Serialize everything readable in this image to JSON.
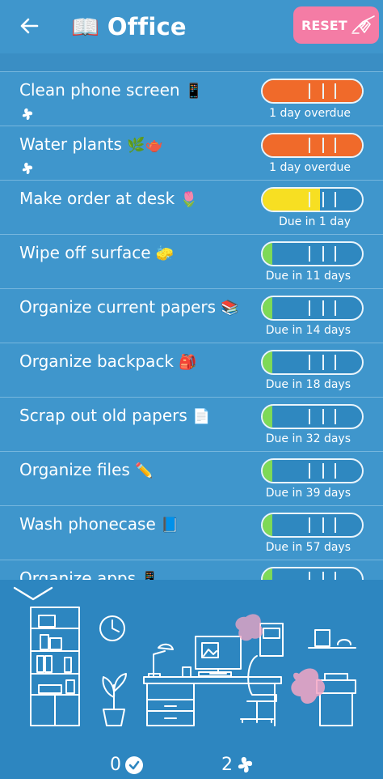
{
  "header": {
    "title": "Office",
    "title_icon": "📖",
    "reset_label": "RESET"
  },
  "tasks": [
    {
      "label": "Clean phone screen",
      "emoji": "📱",
      "due": "1 day  overdue",
      "level": 1.0,
      "status": "overdue",
      "color": "#f06a2a",
      "snoozed": true
    },
    {
      "label": "Water plants",
      "emoji": "🌿🫖",
      "due": "1 day  overdue",
      "level": 1.0,
      "status": "overdue",
      "color": "#f06a2a",
      "snoozed": true
    },
    {
      "label": "Make order at desk",
      "emoji": "🌷",
      "due": "Due in 1 day",
      "level": 0.58,
      "status": "soon",
      "color": "#f7df22",
      "snoozed": false
    },
    {
      "label": "Wipe off surface",
      "emoji": "🧽",
      "due": "Due in 11 days",
      "level": 0.1,
      "status": "ok",
      "color": "#7ed957",
      "snoozed": false
    },
    {
      "label": "Organize current papers",
      "emoji": "📚",
      "due": "Due in 14 days",
      "level": 0.1,
      "status": "ok",
      "color": "#7ed957",
      "snoozed": false
    },
    {
      "label": "Organize backpack",
      "emoji": "🎒",
      "due": "Due in 18 days",
      "level": 0.1,
      "status": "ok",
      "color": "#7ed957",
      "snoozed": false
    },
    {
      "label": "Scrap out old papers",
      "emoji": "📄",
      "due": "Due in 32 days",
      "level": 0.1,
      "status": "ok",
      "color": "#7ed957",
      "snoozed": false
    },
    {
      "label": "Organize files",
      "emoji": "✏️",
      "due": "Due in 39 days",
      "level": 0.1,
      "status": "ok",
      "color": "#7ed957",
      "snoozed": false
    },
    {
      "label": "Wash phonecase",
      "emoji": "📘",
      "due": "Due in 57 days",
      "level": 0.1,
      "status": "ok",
      "color": "#7ed957",
      "snoozed": false
    },
    {
      "label": "Organize apps",
      "emoji": "📱",
      "due": "",
      "level": 0.1,
      "status": "ok",
      "color": "#7ed957",
      "snoozed": false
    }
  ],
  "footer": {
    "done_count": "0",
    "snoozed_count": "2"
  },
  "colors": {
    "background": "#3f96cc",
    "scene": "#2d86c0",
    "reset": "#f47ca5",
    "overdue": "#f06a2a",
    "soon": "#f7df22",
    "ok": "#7ed957",
    "accent_pink": "#f4a6c4"
  }
}
